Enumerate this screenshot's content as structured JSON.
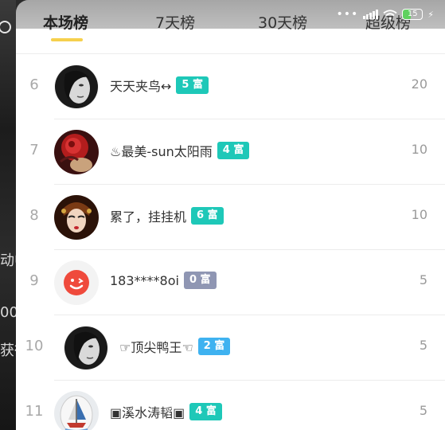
{
  "statusbar": {
    "dots": "•••",
    "battery": "15",
    "signal_icon": "signal-icon",
    "wifi_icon": "wifi-icon",
    "bolt_icon": "charging-icon"
  },
  "background": {
    "fragments": [
      "动中",
      "00",
      "获得"
    ]
  },
  "tabs": [
    {
      "label": "本场榜",
      "active": true
    },
    {
      "label": "7天榜",
      "active": false
    },
    {
      "label": "30天榜",
      "active": false
    },
    {
      "label": "超级榜",
      "active": false
    }
  ],
  "rows": [
    {
      "rank": "6",
      "name": "天天夹鸟↔",
      "badge": "5 富",
      "badge_color": "#1ec8b8",
      "score": "20",
      "avatar": "bw-face"
    },
    {
      "rank": "7",
      "name": "♨最美-sun太阳雨",
      "badge": "4 富",
      "badge_color": "#1ec8b8",
      "score": "10",
      "avatar": "red-flower"
    },
    {
      "rank": "8",
      "name": "累了，挂挂机",
      "badge": "6 富",
      "badge_color": "#1ec8b8",
      "score": "10",
      "avatar": "opera-mask"
    },
    {
      "rank": "9",
      "name": "183****8oi",
      "badge": "0 富",
      "badge_color": "#8f96b3",
      "score": "5",
      "avatar": "red-smiley"
    },
    {
      "rank": "10",
      "name": "☞顶尖鸭王☜",
      "badge": "2 富",
      "badge_color": "#3fb2f0",
      "score": "5",
      "avatar": "bw-face"
    },
    {
      "rank": "11",
      "name": "▣溪水涛韬▣",
      "badge": "4 富",
      "badge_color": "#1ec8b8",
      "score": "5",
      "avatar": "sailboat"
    }
  ]
}
